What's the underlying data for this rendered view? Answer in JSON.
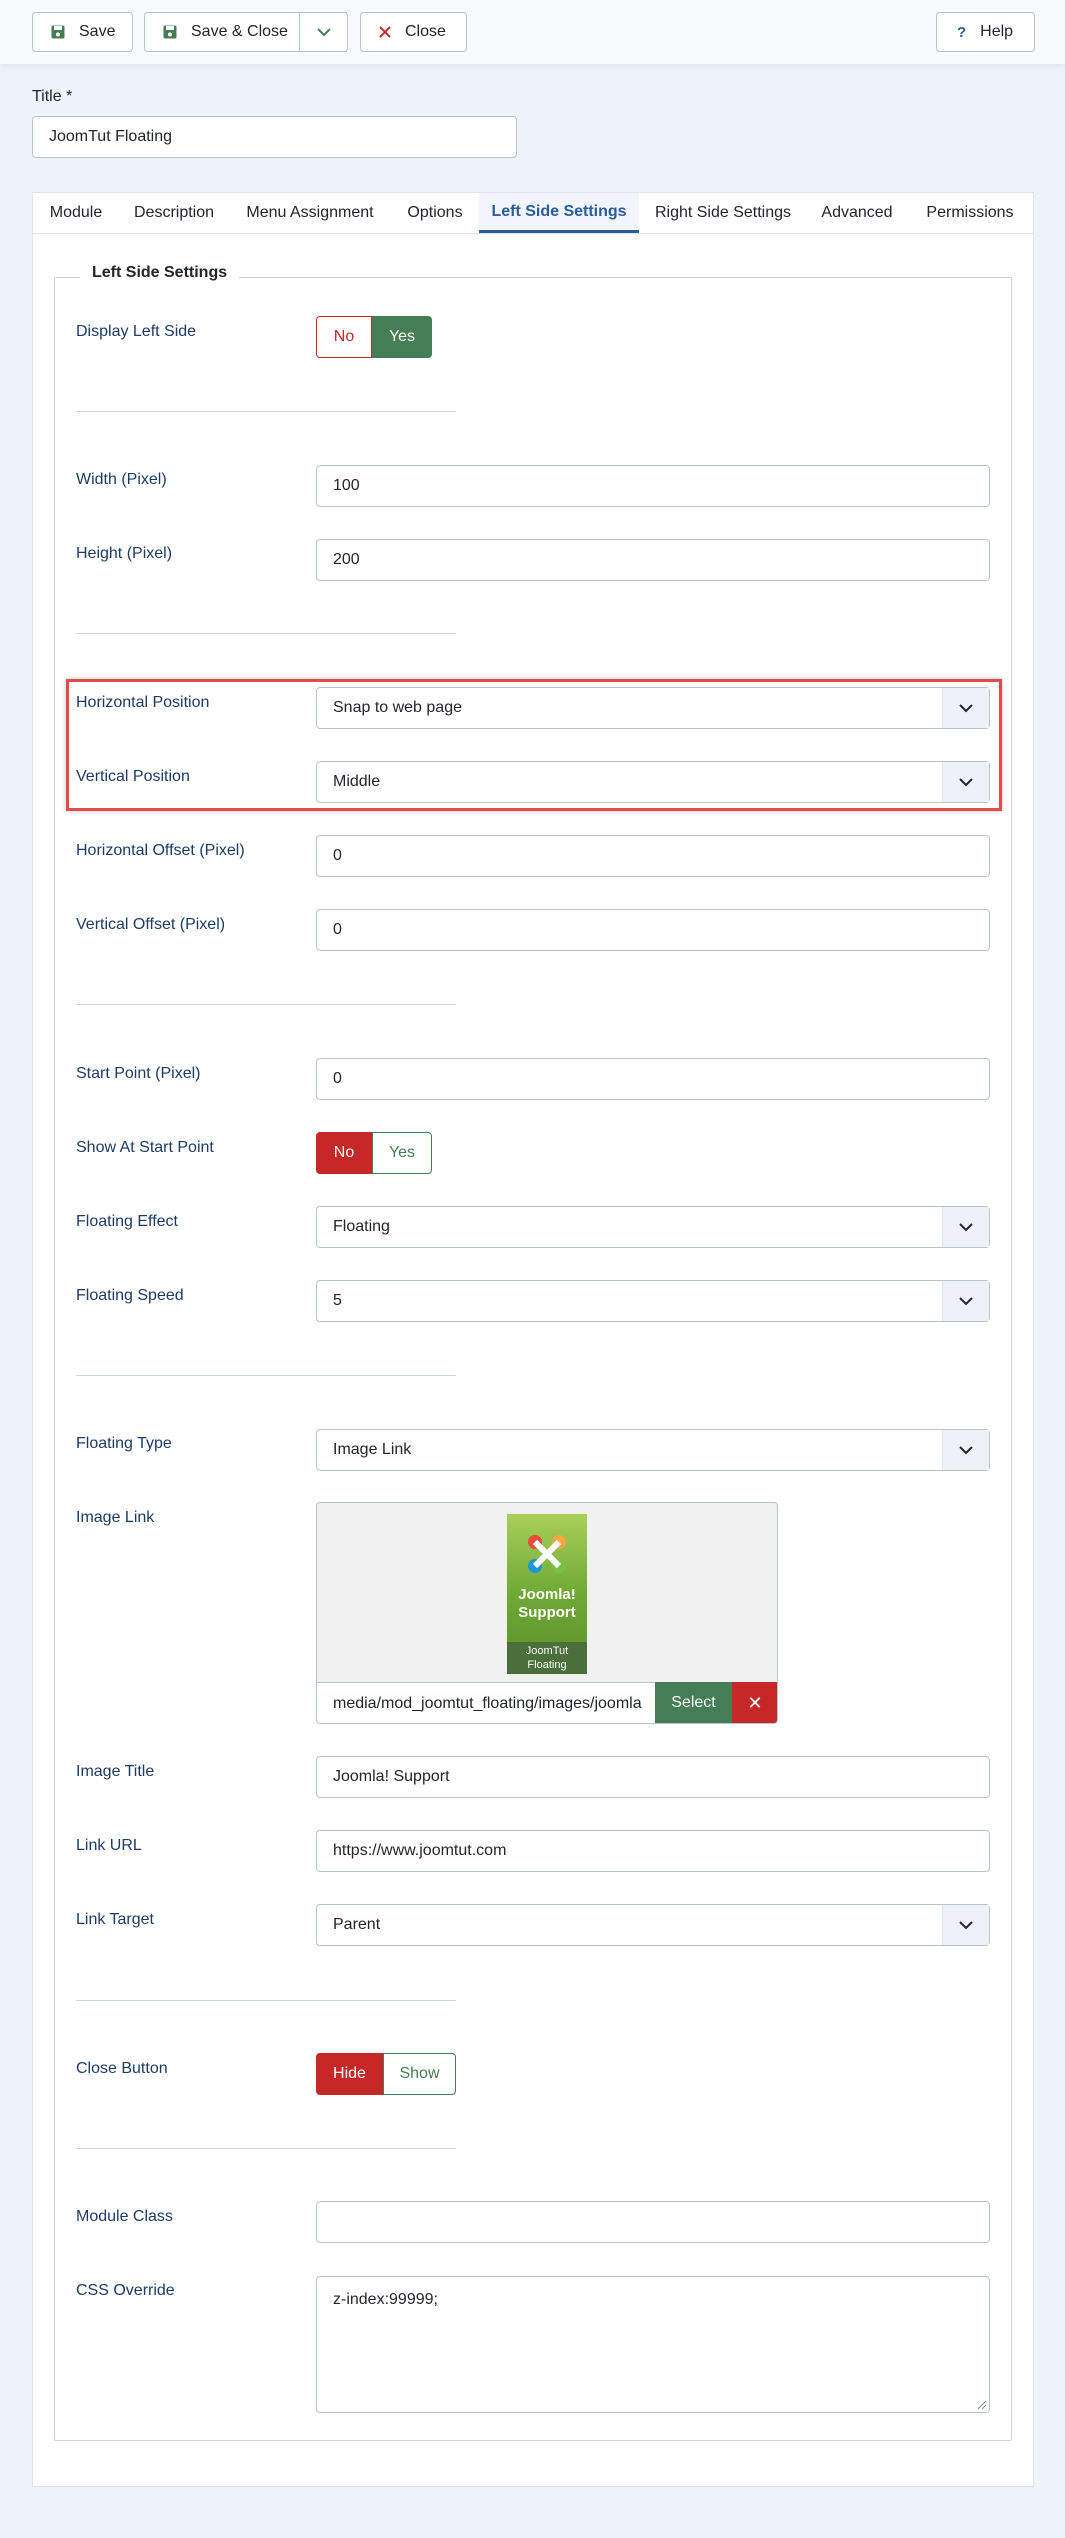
{
  "toolbar": {
    "save": "Save",
    "save_close": "Save & Close",
    "close": "Close",
    "help": "Help"
  },
  "title": {
    "label": "Title *",
    "value": "JoomTut Floating"
  },
  "tabs": [
    {
      "label": "Module"
    },
    {
      "label": "Description"
    },
    {
      "label": "Menu Assignment"
    },
    {
      "label": "Options"
    },
    {
      "label": "Left Side Settings",
      "active": true
    },
    {
      "label": "Right Side Settings"
    },
    {
      "label": "Advanced"
    },
    {
      "label": "Permissions"
    }
  ],
  "fieldset": {
    "legend": "Left Side Settings"
  },
  "fields": {
    "display_left_side": {
      "label": "Display Left Side",
      "off": "No",
      "on": "Yes",
      "selected": "Yes"
    },
    "width": {
      "label": "Width (Pixel)",
      "value": "100"
    },
    "height": {
      "label": "Height (Pixel)",
      "value": "200"
    },
    "horizontal_position": {
      "label": "Horizontal Position",
      "value": "Snap to web page"
    },
    "vertical_position": {
      "label": "Vertical Position",
      "value": "Middle"
    },
    "horizontal_offset": {
      "label": "Horizontal Offset (Pixel)",
      "value": "0"
    },
    "vertical_offset": {
      "label": "Vertical Offset (Pixel)",
      "value": "0"
    },
    "start_point": {
      "label": "Start Point (Pixel)",
      "value": "0"
    },
    "show_at_start": {
      "label": "Show At Start Point",
      "off": "No",
      "on": "Yes",
      "selected": "No"
    },
    "floating_effect": {
      "label": "Floating Effect",
      "value": "Floating"
    },
    "floating_speed": {
      "label": "Floating Speed",
      "value": "5"
    },
    "floating_type": {
      "label": "Floating Type",
      "value": "Image Link"
    },
    "image_link": {
      "label": "Image Link",
      "path": "media/mod_joomtut_floating/images/joomla",
      "select": "Select",
      "clear": "✕",
      "thumb_title": "Joomla! Support",
      "thumb_caption": "JoomTut Floating"
    },
    "image_title": {
      "label": "Image Title",
      "value": "Joomla! Support"
    },
    "link_url": {
      "label": "Link URL",
      "value": "https://www.joomtut.com"
    },
    "link_target": {
      "label": "Link Target",
      "value": "Parent"
    },
    "close_button": {
      "label": "Close Button",
      "off": "Hide",
      "on": "Show",
      "selected": "Hide"
    },
    "module_class": {
      "label": "Module Class",
      "value": ""
    },
    "css_override": {
      "label": "CSS Override",
      "value": "z-index:99999;"
    }
  },
  "colors": {
    "primary": "#2a5b9c",
    "success": "#457d54",
    "danger": "#c52827",
    "highlight": "#e34a4a"
  }
}
